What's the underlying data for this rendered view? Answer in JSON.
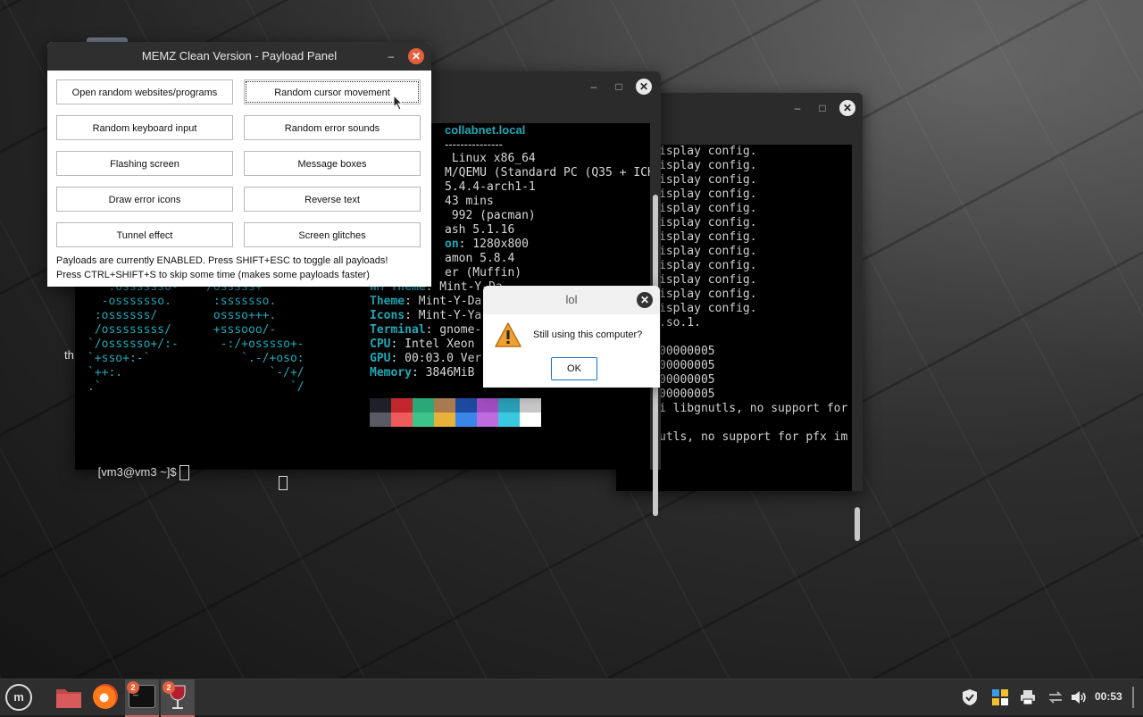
{
  "memz": {
    "title": "MEMZ Clean Version - Payload Panel",
    "buttons": [
      "Open random websites/programs",
      "Random cursor movement",
      "Random keyboard input",
      "Random error sounds",
      "Flashing screen",
      "Message boxes",
      "Draw error icons",
      "Reverse text",
      "Tunnel effect",
      "Screen glitches"
    ],
    "status_line1": "Payloads are currently ENABLED. Press SHIFT+ESC to toggle all payloads!",
    "status_line2": "Press CTRL+SHIFT+S to skip some time (makes some payloads faster)"
  },
  "lol_dialog": {
    "title": "lol",
    "message": "Still using this computer?",
    "ok": "OK"
  },
  "terminal1": {
    "host_line": "collabnet.local",
    "separator": "---------------",
    "info": [
      {
        "key": "",
        "value": " Linux x86_64"
      },
      {
        "key": "",
        "value": "M/QEMU (Standard PC (Q35 + ICH"
      },
      {
        "key": "",
        "value": "5.4.4-arch1-1"
      },
      {
        "key": "",
        "value": "43 mins"
      },
      {
        "key": "",
        "value": " 992 (pacman)"
      },
      {
        "key": "",
        "value": "ash 5.1.16"
      },
      {
        "key": "on",
        "value": ": 1280x800"
      },
      {
        "key": "",
        "value": "amon 5.8.4"
      },
      {
        "key": "",
        "value": "er (Muffin)"
      },
      {
        "key": "WM Theme",
        "value": ": Mint-Y-Da"
      },
      {
        "key": "Theme",
        "value": ": Mint-Y-Da"
      },
      {
        "key": "Icons",
        "value": ": Mint-Y-Ya"
      },
      {
        "key": "Terminal",
        "value": ": gnome-"
      },
      {
        "key": "CPU",
        "value": ": Intel Xeon"
      },
      {
        "key": "GPU",
        "value": ": 00:03.0 Ver"
      },
      {
        "key": "Memory",
        "value": ": 3846MiB"
      }
    ],
    "ascii_art": [
      "   :ossssss0-    /osssss+",
      "  -osssssso.      :sssssso.",
      " :ossssss/        ossso+++.",
      " /ossssssss/      +sssooo/-",
      "`/ossssso+/:-      -:/+osssso+-",
      "`+sso+:-`             `.-/+oso:",
      "`++:.                     `-/+/",
      ".`                           `/"
    ],
    "prompt": "[vm3@vm3 ~]$ ",
    "swatches_top": [
      "#1f1f28",
      "#c4262e",
      "#2aa877",
      "#a87a4e",
      "#1c4aa0",
      "#a24ec2",
      "#2aa0b8",
      "#c8c8c8"
    ],
    "swatches_bottom": [
      "#5a5a66",
      "#ef5a5a",
      "#3ec48a",
      "#e8b23a",
      "#3a86e8",
      "#c06ae0",
      "#3ac8e0",
      "#ffffff"
    ],
    "left_fragment": "th"
  },
  "terminal2": {
    "lines": [
      "isplay config.",
      "isplay config.",
      "isplay config.",
      "isplay config.",
      "isplay config.",
      "isplay config.",
      "isplay config.",
      "isplay config.",
      "isplay config.",
      "isplay config.",
      "isplay config.",
      "isplay config.",
      ".so.1.",
      "",
      "00000005",
      "00000005",
      "00000005",
      "00000005",
      "i libgnutls, no support for",
      "",
      "utls, no support for pfx im"
    ]
  },
  "taskbar": {
    "terminal_badge": "2",
    "wine_badge": "2",
    "clock": "00:53"
  },
  "colors": {
    "accent_close": "#e2613c",
    "terminal_cyan": "#1ea9b8"
  }
}
